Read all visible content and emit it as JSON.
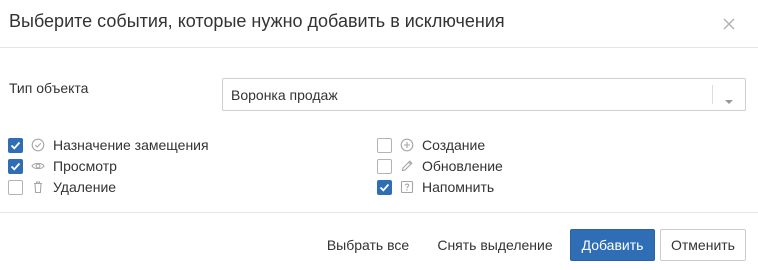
{
  "dialog": {
    "title": "Выберите события, которые нужно добавить в исключения",
    "close_icon": "close-icon"
  },
  "object_type": {
    "label": "Тип объекта",
    "selected": "Воронка продаж",
    "arrow_icon": "chevron-down-icon"
  },
  "events": {
    "left": [
      {
        "label": "Назначение замещения",
        "checked": true,
        "icon": "check-circle-icon"
      },
      {
        "label": "Просмотр",
        "checked": true,
        "icon": "eye-icon"
      },
      {
        "label": "Удаление",
        "checked": false,
        "icon": "trash-icon"
      }
    ],
    "right": [
      {
        "label": "Создание",
        "checked": false,
        "icon": "plus-circle-icon"
      },
      {
        "label": "Обновление",
        "checked": false,
        "icon": "pencil-icon"
      },
      {
        "label": "Напомнить",
        "checked": true,
        "icon": "question-square-icon"
      }
    ]
  },
  "footer": {
    "select_all": "Выбрать все",
    "clear_selection": "Снять выделение",
    "add": "Добавить",
    "cancel": "Отменить"
  },
  "colors": {
    "accent": "#2f6eb5",
    "text": "#333333",
    "icon_gray": "#a6a6a6"
  }
}
